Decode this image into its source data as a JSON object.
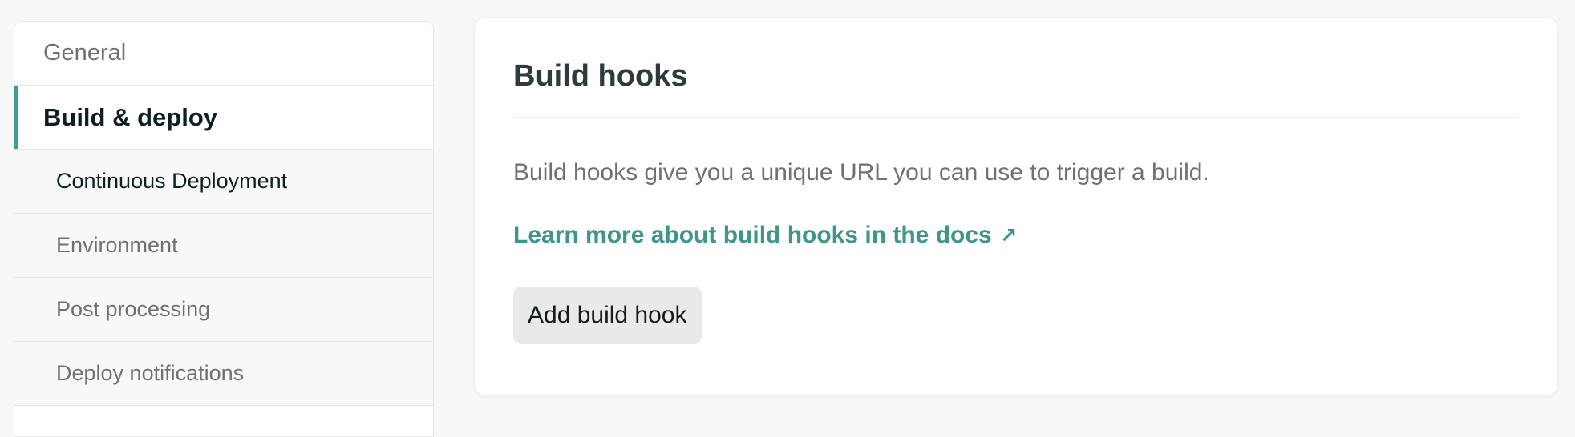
{
  "sidebar": {
    "items": [
      {
        "label": "General"
      },
      {
        "label": "Build & deploy"
      }
    ],
    "subitems": [
      {
        "label": "Continuous Deployment"
      },
      {
        "label": "Environment"
      },
      {
        "label": "Post processing"
      },
      {
        "label": "Deploy notifications"
      }
    ]
  },
  "main": {
    "section_title": "Build hooks",
    "description": "Build hooks give you a unique URL you can use to trigger a build.",
    "docs_link": "Learn more about build hooks in the docs",
    "docs_link_icon": "↗",
    "add_button": "Add build hook"
  },
  "colors": {
    "accent": "#3d9687",
    "active_indicator": "#3d9f8e",
    "button_bg": "#e8eaea"
  }
}
